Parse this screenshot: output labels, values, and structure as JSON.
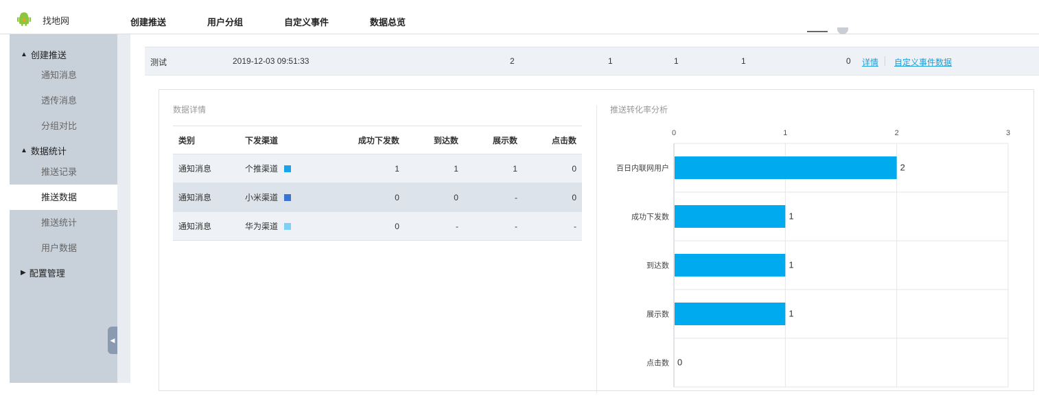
{
  "brand": {
    "name": "找地网",
    "icon": "android-icon",
    "icon_color": "#8cc63f"
  },
  "nav": {
    "items": [
      "创建推送",
      "用户分组",
      "自定义事件",
      "数据总览"
    ]
  },
  "sidebar": {
    "groups": [
      {
        "label": "创建推送",
        "expanded": true,
        "items": [
          {
            "label": "通知消息",
            "active": false
          },
          {
            "label": "透传消息",
            "active": false
          },
          {
            "label": "分组对比",
            "active": false
          }
        ]
      },
      {
        "label": "数据统计",
        "expanded": true,
        "items": [
          {
            "label": "推送记录",
            "active": false
          },
          {
            "label": "推送数据",
            "active": true
          },
          {
            "label": "推送统计",
            "active": false
          },
          {
            "label": "用户数据",
            "active": false
          }
        ]
      },
      {
        "label": "配置管理",
        "expanded": false,
        "items": []
      }
    ],
    "collapse_icon": "collapse-left-icon"
  },
  "summary": {
    "name": "测试",
    "time": "2019-12-03 09:51:33",
    "v1": "2",
    "v2": "1",
    "v3": "1",
    "v4": "1",
    "v5": "0",
    "detail_link": "详情",
    "custom_link": "自定义事件数据"
  },
  "details": {
    "title": "数据详情",
    "columns": [
      "类别",
      "下发渠道",
      "成功下发数",
      "到达数",
      "展示数",
      "点击数"
    ],
    "rows": [
      {
        "category": "通知消息",
        "channel": "个推渠道",
        "color": "#1aa3e8",
        "sent": "1",
        "arrived": "1",
        "shown": "1",
        "clicked": "0"
      },
      {
        "category": "通知消息",
        "channel": "小米渠道",
        "color": "#3a75d6",
        "sent": "0",
        "arrived": "0",
        "shown": "-",
        "clicked": "0"
      },
      {
        "category": "通知消息",
        "channel": "华为渠道",
        "color": "#7fd0f5",
        "sent": "0",
        "arrived": "-",
        "shown": "-",
        "clicked": "-"
      }
    ]
  },
  "chart": {
    "title": "推送转化率分析"
  },
  "chart_data": {
    "type": "bar",
    "orientation": "horizontal",
    "categories": [
      "百日内联网用户",
      "成功下发数",
      "到达数",
      "展示数",
      "点击数"
    ],
    "values": [
      2,
      1,
      1,
      1,
      0
    ],
    "xlim": [
      0,
      3
    ],
    "xticks": [
      0,
      1,
      2,
      3
    ],
    "grid": true,
    "bar_color": "#00aaee",
    "data_labels": true
  }
}
